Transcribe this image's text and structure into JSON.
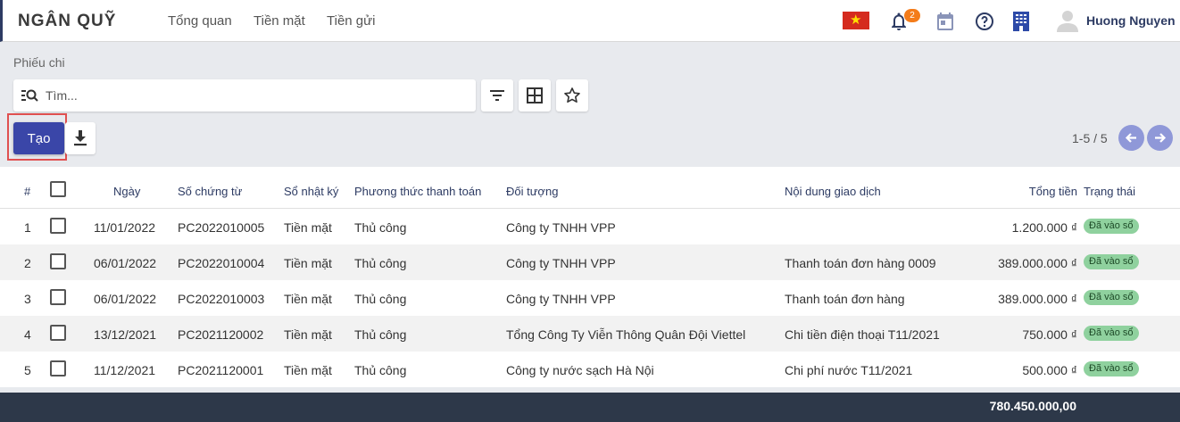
{
  "app": {
    "title": "NGÂN QUỸ",
    "nav": [
      "Tổng quan",
      "Tiền mặt",
      "Tiền gửi"
    ],
    "notifications": "2",
    "user": "Huong Nguyen",
    "flag": "★"
  },
  "breadcrumb": "Phiếu chi",
  "search": {
    "placeholder": "Tìm...",
    "value": ""
  },
  "toolbar": {
    "create": "Tạo",
    "pager": "1-5 / 5"
  },
  "table": {
    "headers": [
      "#",
      "Ngày",
      "Số chứng từ",
      "Sổ nhật ký",
      "Phương thức thanh toán",
      "Đối tượng",
      "Nội dung giao dịch",
      "Tổng tiền",
      "Trạng thái"
    ],
    "rows": [
      {
        "no": "1",
        "date": "11/01/2022",
        "doc": "PC2022010005",
        "journal": "Tiền mặt",
        "method": "Thủ công",
        "partner": "Công ty TNHH VPP",
        "content": "",
        "amount": "1.200.000 ₫",
        "status": "Đã vào sổ"
      },
      {
        "no": "2",
        "date": "06/01/2022",
        "doc": "PC2022010004",
        "journal": "Tiền mặt",
        "method": "Thủ công",
        "partner": "Công ty TNHH VPP",
        "content": "Thanh toán đơn hàng 0009",
        "amount": "389.000.000 ₫",
        "status": "Đã vào sổ"
      },
      {
        "no": "3",
        "date": "06/01/2022",
        "doc": "PC2022010003",
        "journal": "Tiền mặt",
        "method": "Thủ công",
        "partner": "Công ty TNHH VPP",
        "content": "Thanh toán đơn hàng",
        "amount": "389.000.000 ₫",
        "status": "Đã vào sổ"
      },
      {
        "no": "4",
        "date": "13/12/2021",
        "doc": "PC2021120002",
        "journal": "Tiền mặt",
        "method": "Thủ công",
        "partner": "Tổng Công Ty Viễn Thông Quân Đội Viettel",
        "content": "Chi tiền điện thoại T11/2021",
        "amount": "750.000 ₫",
        "status": "Đã vào sổ"
      },
      {
        "no": "5",
        "date": "11/12/2021",
        "doc": "PC2021120001",
        "journal": "Tiền mặt",
        "method": "Thủ công",
        "partner": "Công ty nước sạch Hà Nội",
        "content": "Chi phí nước T11/2021",
        "amount": "500.000 ₫",
        "status": "Đã vào sổ"
      }
    ],
    "total": "780.450.000,00"
  },
  "colors": {
    "primary": "#3a46a8",
    "header": "#2d3b63",
    "status_bg": "#8fd19e",
    "footer": "#2d3849"
  }
}
